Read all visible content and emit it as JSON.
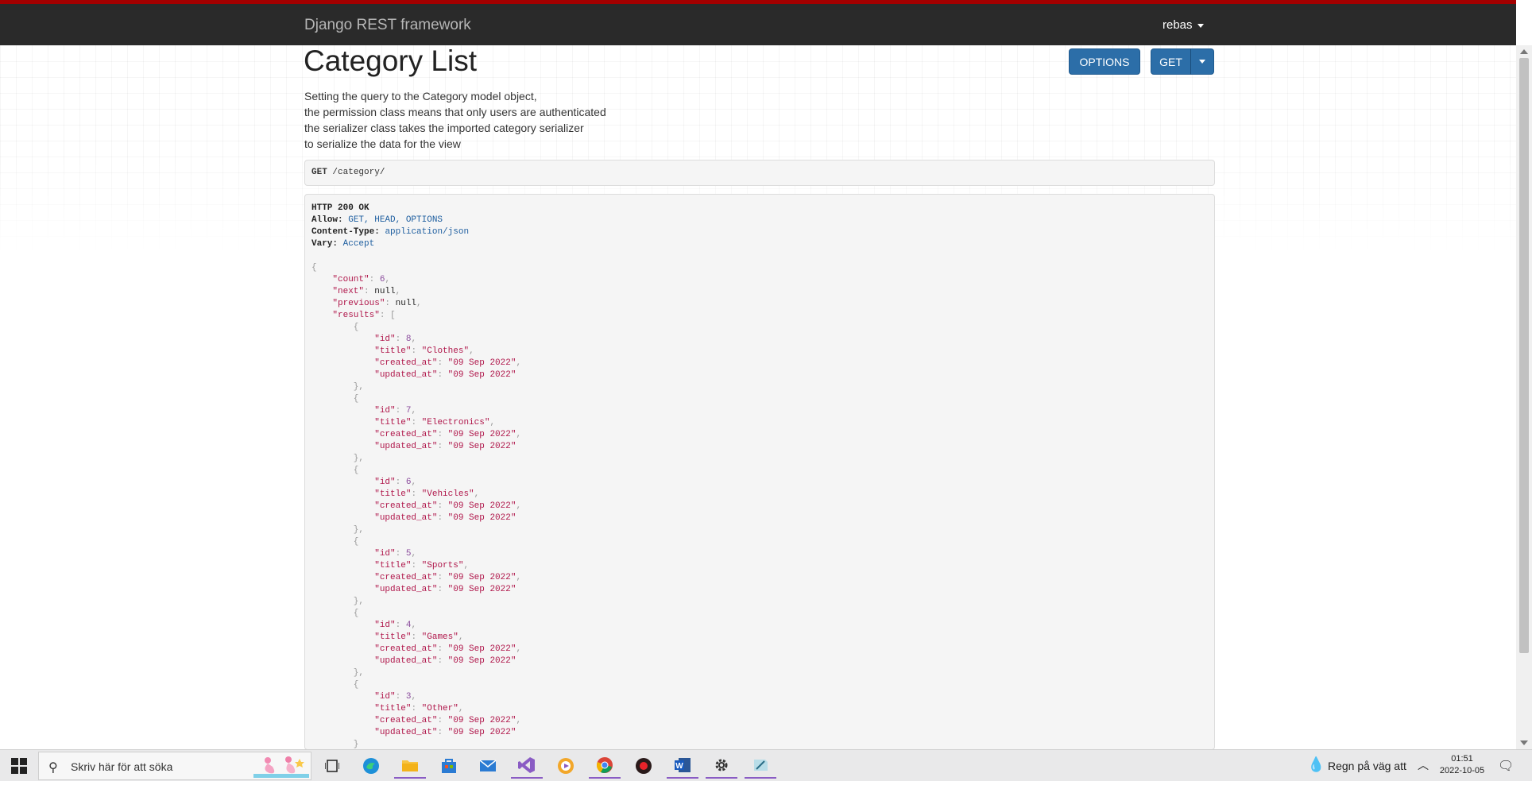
{
  "navbar": {
    "brand": "Django REST framework",
    "user": "rebas"
  },
  "header": {
    "title": "Category List",
    "options_label": "OPTIONS",
    "get_label": "GET"
  },
  "description": [
    "Setting the query to the Category model object,",
    "the permission class means that only users are authenticated",
    "the serializer class takes the imported category serializer",
    "to serialize the data for the view"
  ],
  "request": {
    "method": "GET",
    "path": "/category/"
  },
  "response": {
    "status": "HTTP 200 OK",
    "headers": [
      {
        "key": "Allow:",
        "value": "GET, HEAD, OPTIONS"
      },
      {
        "key": "Content-Type:",
        "value": "application/json"
      },
      {
        "key": "Vary:",
        "value": "Accept"
      }
    ],
    "count": "6",
    "next": "null",
    "previous": "null",
    "results": [
      {
        "id": "8",
        "title": "\"Clothes\"",
        "created_at": "\"09 Sep 2022\"",
        "updated_at": "\"09 Sep 2022\""
      },
      {
        "id": "7",
        "title": "\"Electronics\"",
        "created_at": "\"09 Sep 2022\"",
        "updated_at": "\"09 Sep 2022\""
      },
      {
        "id": "6",
        "title": "\"Vehicles\"",
        "created_at": "\"09 Sep 2022\"",
        "updated_at": "\"09 Sep 2022\""
      },
      {
        "id": "5",
        "title": "\"Sports\"",
        "created_at": "\"09 Sep 2022\"",
        "updated_at": "\"09 Sep 2022\""
      },
      {
        "id": "4",
        "title": "\"Games\"",
        "created_at": "\"09 Sep 2022\"",
        "updated_at": "\"09 Sep 2022\""
      },
      {
        "id": "3",
        "title": "\"Other\"",
        "created_at": "\"09 Sep 2022\"",
        "updated_at": "\"09 Sep 2022\""
      }
    ]
  },
  "taskbar": {
    "search_placeholder": "Skriv här för att söka",
    "icons": [
      "task-view-icon",
      "edge-icon",
      "file-explorer-icon",
      "store-icon",
      "mail-icon",
      "visual-studio-icon",
      "app-icon",
      "chrome-icon",
      "record-icon",
      "word-icon",
      "settings-icon",
      "notepad-icon"
    ],
    "weather": "Regn på väg att",
    "time": "01:51",
    "date": "2022-10-05"
  },
  "colors": {
    "navbar_bg": "#2a2a2a",
    "navbar_accent": "#a30000",
    "button": "#2c6ea8",
    "json_key": "#b0174b"
  }
}
